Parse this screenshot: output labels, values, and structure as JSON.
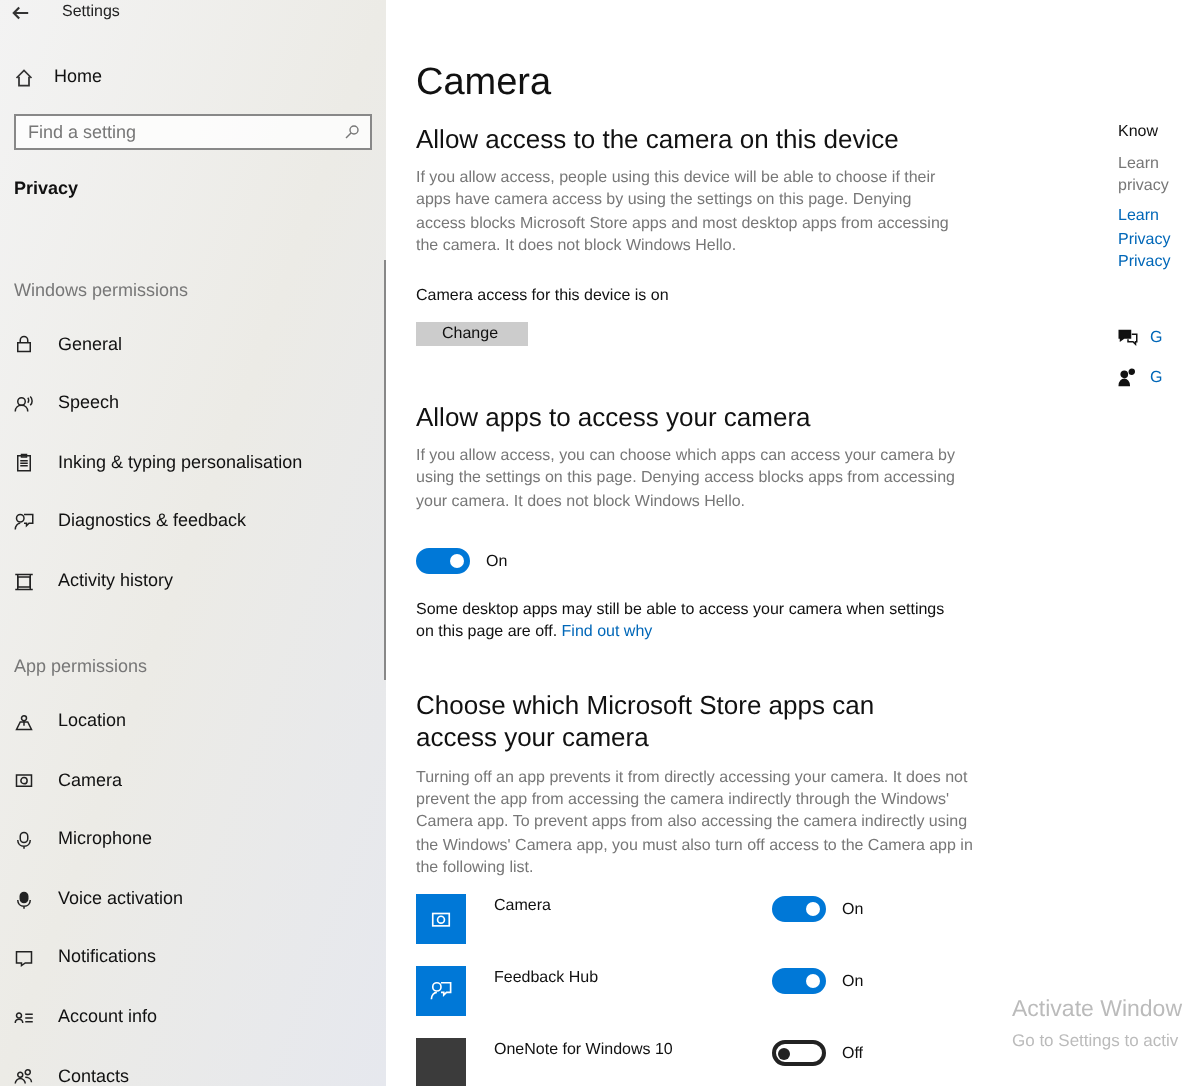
{
  "window": {
    "title": "Settings"
  },
  "sidebar": {
    "home": "Home",
    "search": {
      "placeholder": "Find a setting"
    },
    "section_title": "Privacy",
    "groups": [
      {
        "heading": "Windows permissions",
        "items": [
          {
            "label": "General",
            "kind": "lock"
          },
          {
            "label": "Speech",
            "kind": "speech"
          },
          {
            "label": "Inking & typing personalisation",
            "kind": "clipboard"
          },
          {
            "label": "Diagnostics & feedback",
            "kind": "feedback"
          },
          {
            "label": "Activity history",
            "kind": "history"
          }
        ]
      },
      {
        "heading": "App permissions",
        "items": [
          {
            "label": "Location",
            "kind": "location"
          },
          {
            "label": "Camera",
            "kind": "camera"
          },
          {
            "label": "Microphone",
            "kind": "mic"
          },
          {
            "label": "Voice activation",
            "kind": "voice"
          },
          {
            "label": "Notifications",
            "kind": "notification"
          },
          {
            "label": "Account info",
            "kind": "account"
          },
          {
            "label": "Contacts",
            "kind": "contacts"
          }
        ]
      }
    ]
  },
  "main": {
    "title": "Camera",
    "device_section": {
      "heading": "Allow access to the camera on this device",
      "description": "If you allow access, people using this device will be able to choose if their apps have camera access by using the settings on this page. Denying access blocks Microsoft Store apps and most desktop apps from accessing the camera. It does not block Windows Hello.",
      "status": "Camera access for this device is on",
      "button": "Change"
    },
    "apps_section": {
      "heading": "Allow apps to access your camera",
      "description": "If you allow access, you can choose which apps can access your camera by using the settings on this page. Denying access blocks apps from accessing your camera. It does not block Windows Hello.",
      "toggle": {
        "on": true,
        "label": "On"
      },
      "note": "Some desktop apps may still be able to access your camera when settings on this page are off.",
      "link": "Find out why"
    },
    "store_section": {
      "heading": "Choose which Microsoft Store apps can access your camera",
      "description": "Turning off an app prevents it from directly accessing your camera. It does not prevent the app from accessing the camera indirectly through the Windows' Camera app. To prevent apps from also accessing the camera indirectly using the Windows' Camera app, you must also turn off access to the Camera app in the following list.",
      "apps": [
        {
          "name": "Camera",
          "kind": "camera",
          "color": "#0078d7",
          "on": true,
          "label": "On"
        },
        {
          "name": "Feedback Hub",
          "kind": "feedback",
          "color": "#0078d7",
          "on": true,
          "label": "On"
        },
        {
          "name": "OneNote for Windows 10",
          "kind": "onenote",
          "color": "#3b3b3b",
          "on": false,
          "label": "Off"
        }
      ]
    }
  },
  "right_panel": {
    "heading": "Know",
    "lines": [
      "Learn",
      "privacy"
    ],
    "links": [
      "Learn",
      "Privacy",
      "Privacy"
    ],
    "help": [
      {
        "kind": "chat",
        "label": "G"
      },
      {
        "kind": "people",
        "label": "G"
      }
    ]
  },
  "activation_notice": {
    "title": "Activate Window",
    "subtitle": "Go to Settings to activ"
  }
}
